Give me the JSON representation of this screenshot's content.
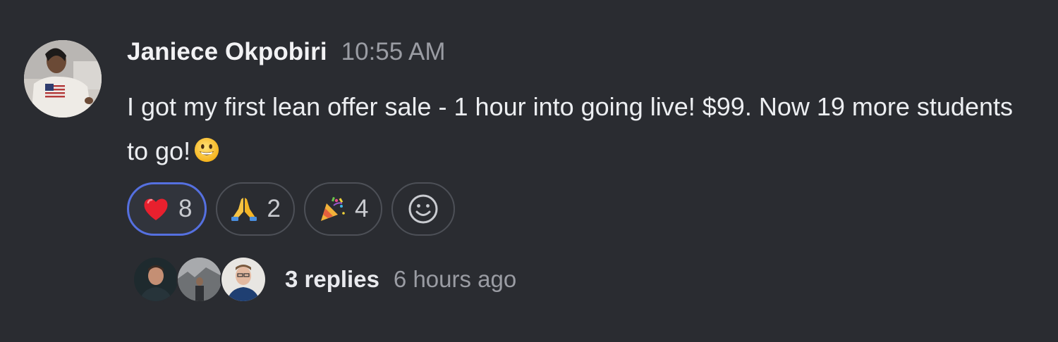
{
  "message": {
    "author": "Janiece Okpobiri",
    "time": "10:55 AM",
    "text": "I got my first lean offer sale - 1 hour into going live! $99. Now 19 more students to go!",
    "text_emoji": "smiley-emoji"
  },
  "reactions": [
    {
      "emoji": "red-heart",
      "count": "8",
      "active": true
    },
    {
      "emoji": "folded-hands",
      "count": "2",
      "active": false
    },
    {
      "emoji": "party-popper",
      "count": "4",
      "active": false
    }
  ],
  "add_reaction_icon": "smiley-outline-icon",
  "thread": {
    "replies": "3 replies",
    "last_reply": "6 hours ago"
  },
  "colors": {
    "background": "#2a2c31",
    "active_reaction_border": "#5570e0",
    "reaction_border": "#4d5057",
    "muted_text": "#9a9ca3"
  }
}
